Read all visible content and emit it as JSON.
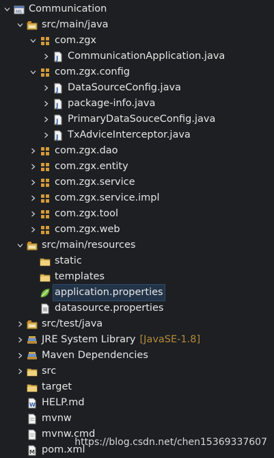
{
  "tree": [
    {
      "depth": 0,
      "open": true,
      "icon": "project-icon",
      "label": "Communication",
      "name": "tree-item-communication"
    },
    {
      "depth": 1,
      "open": true,
      "icon": "source-folder-icon",
      "label": "src/main/java",
      "name": "tree-item-src-main-java"
    },
    {
      "depth": 2,
      "open": true,
      "icon": "package-icon",
      "label": "com.zgx",
      "name": "tree-item-com-zgx"
    },
    {
      "depth": 3,
      "open": false,
      "icon": "java-file-icon",
      "label": "CommunicationApplication.java",
      "name": "tree-item-communicationapplication-java"
    },
    {
      "depth": 2,
      "open": true,
      "icon": "package-icon",
      "label": "com.zgx.config",
      "name": "tree-item-com-zgx-config"
    },
    {
      "depth": 3,
      "open": false,
      "icon": "java-file-icon",
      "label": "DataSourceConfig.java",
      "name": "tree-item-datasourceconfig-java"
    },
    {
      "depth": 3,
      "open": false,
      "icon": "java-file-icon",
      "label": "package-info.java",
      "name": "tree-item-package-info-java"
    },
    {
      "depth": 3,
      "open": false,
      "icon": "java-file-icon",
      "label": "PrimaryDataSouceConfig.java",
      "name": "tree-item-primarydatasouceconfig-java"
    },
    {
      "depth": 3,
      "open": false,
      "icon": "java-file-icon",
      "label": "TxAdviceInterceptor.java",
      "name": "tree-item-txadviceinterceptor-java"
    },
    {
      "depth": 2,
      "open": false,
      "icon": "package-icon",
      "label": "com.zgx.dao",
      "name": "tree-item-com-zgx-dao"
    },
    {
      "depth": 2,
      "open": false,
      "icon": "package-icon",
      "label": "com.zgx.entity",
      "name": "tree-item-com-zgx-entity"
    },
    {
      "depth": 2,
      "open": false,
      "icon": "package-icon",
      "label": "com.zgx.service",
      "name": "tree-item-com-zgx-service"
    },
    {
      "depth": 2,
      "open": false,
      "icon": "package-icon",
      "label": "com.zgx.service.impl",
      "name": "tree-item-com-zgx-service-impl"
    },
    {
      "depth": 2,
      "open": false,
      "icon": "package-icon",
      "label": "com.zgx.tool",
      "name": "tree-item-com-zgx-tool"
    },
    {
      "depth": 2,
      "open": false,
      "icon": "package-icon",
      "label": "com.zgx.web",
      "name": "tree-item-com-zgx-web"
    },
    {
      "depth": 1,
      "open": true,
      "icon": "source-folder-icon",
      "label": "src/main/resources",
      "name": "tree-item-src-main-resources"
    },
    {
      "depth": 2,
      "leaf": true,
      "icon": "folder-icon",
      "label": "static",
      "name": "tree-item-static"
    },
    {
      "depth": 2,
      "leaf": true,
      "icon": "folder-icon",
      "label": "templates",
      "name": "tree-item-templates"
    },
    {
      "depth": 2,
      "leaf": true,
      "icon": "spring-leaf-icon",
      "label": "application.properties",
      "name": "tree-item-application-properties",
      "selected": true
    },
    {
      "depth": 2,
      "leaf": true,
      "icon": "properties-file-icon",
      "label": "datasource.properties",
      "name": "tree-item-datasource-properties"
    },
    {
      "depth": 1,
      "open": false,
      "icon": "source-folder-icon",
      "label": "src/test/java",
      "name": "tree-item-src-test-java"
    },
    {
      "depth": 1,
      "open": false,
      "icon": "library-icon",
      "label": "JRE System Library",
      "decor": "[JavaSE-1.8]",
      "name": "tree-item-jre-system-library"
    },
    {
      "depth": 1,
      "open": false,
      "icon": "library-icon",
      "label": "Maven Dependencies",
      "name": "tree-item-maven-dependencies"
    },
    {
      "depth": 1,
      "open": false,
      "icon": "folder-icon",
      "label": "src",
      "name": "tree-item-src"
    },
    {
      "depth": 1,
      "leaf": true,
      "icon": "folder-icon",
      "label": "target",
      "name": "tree-item-target"
    },
    {
      "depth": 1,
      "leaf": true,
      "icon": "markdown-file-icon",
      "label": "HELP.md",
      "name": "tree-item-help-md"
    },
    {
      "depth": 1,
      "leaf": true,
      "icon": "text-file-icon",
      "label": "mvnw",
      "name": "tree-item-mvnw"
    },
    {
      "depth": 1,
      "leaf": true,
      "icon": "text-file-icon",
      "label": "mvnw.cmd",
      "name": "tree-item-mvnw-cmd"
    },
    {
      "depth": 1,
      "leaf": true,
      "icon": "maven-pom-icon",
      "label": "pom.xml",
      "name": "tree-item-pom-xml"
    }
  ],
  "watermark": "https://blog.csdn.net/chen15369337607"
}
